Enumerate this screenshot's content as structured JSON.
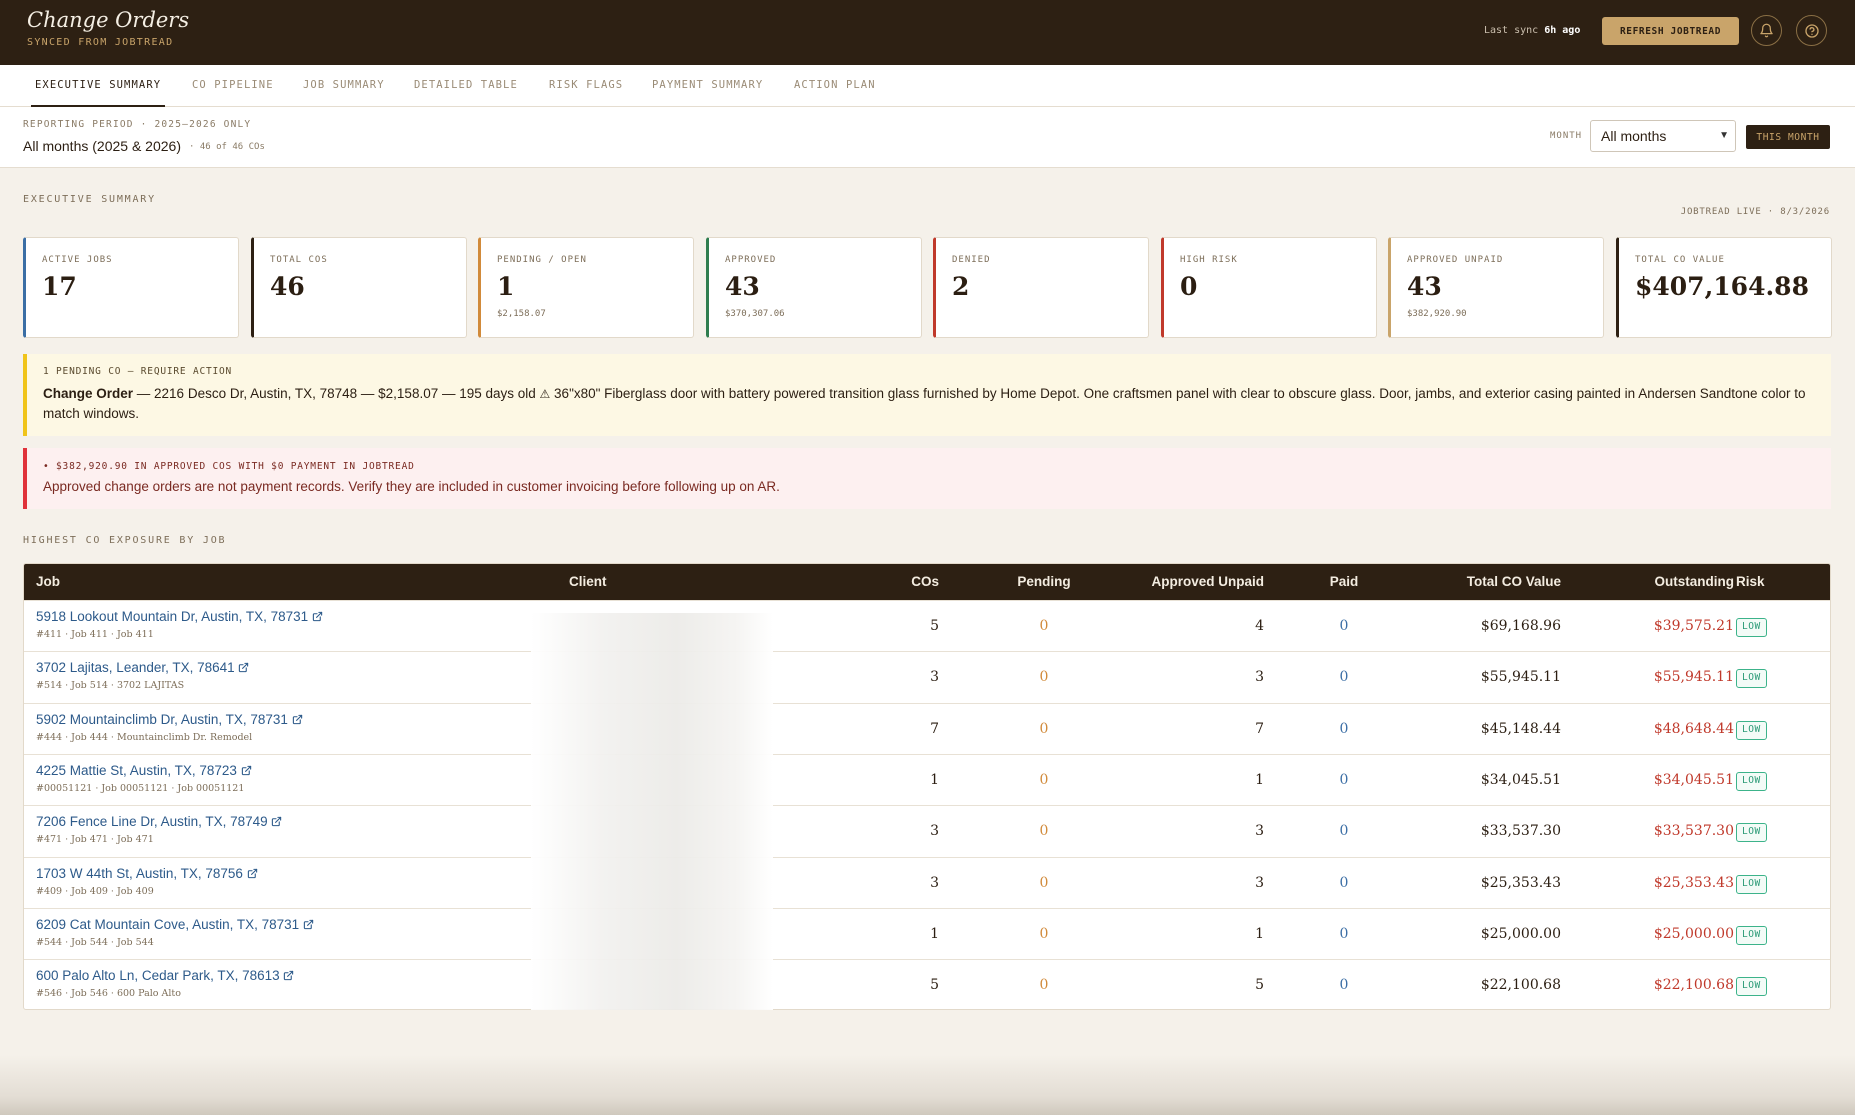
{
  "header": {
    "title": "Change Orders",
    "subtitle": "SYNCED FROM JOBTREAD",
    "sync_prefix": "Last sync",
    "sync_value": "6h ago",
    "refresh_label": "REFRESH JOBTREAD",
    "bell_icon": "bell-icon",
    "help_icon": "help-circle-icon"
  },
  "tabs": [
    {
      "label": "EXECUTIVE SUMMARY",
      "active": true
    },
    {
      "label": "CO PIPELINE",
      "active": false
    },
    {
      "label": "JOB SUMMARY",
      "active": false
    },
    {
      "label": "DETAILED TABLE",
      "active": false
    },
    {
      "label": "RISK FLAGS",
      "active": false
    },
    {
      "label": "PAYMENT SUMMARY",
      "active": false
    },
    {
      "label": "ACTION PLAN",
      "active": false
    }
  ],
  "period": {
    "label": "REPORTING PERIOD · 2025–2026 ONLY",
    "value": "All months (2025 & 2026)",
    "count": "· 46 of 46 COs",
    "month_label": "MONTH",
    "month_selected": "All months",
    "this_month_label": "THIS MONTH"
  },
  "summary": {
    "section_label": "EXECUTIVE SUMMARY",
    "live_label": "JOBTREAD LIVE · 8/3/2026",
    "cards": [
      {
        "label": "ACTIVE JOBS",
        "value": "17",
        "sub": "",
        "accent": "#3b6ea5"
      },
      {
        "label": "TOTAL COS",
        "value": "46",
        "sub": "",
        "accent": "#2d2013"
      },
      {
        "label": "PENDING / OPEN",
        "value": "1",
        "sub": "$2,158.07",
        "accent": "#d18a3a"
      },
      {
        "label": "APPROVED",
        "value": "43",
        "sub": "$370,307.06",
        "accent": "#2f7d4f"
      },
      {
        "label": "DENIED",
        "value": "2",
        "sub": "",
        "accent": "#c0392b"
      },
      {
        "label": "HIGH RISK",
        "value": "0",
        "sub": "",
        "accent": "#c0392b"
      },
      {
        "label": "APPROVED UNPAID",
        "value": "43",
        "sub": "$382,920.90",
        "accent": "#c9a46a"
      },
      {
        "label": "TOTAL CO VALUE",
        "value": "$407,164.88",
        "sub": "",
        "accent": "#2d2013"
      }
    ]
  },
  "alerts": {
    "pending": {
      "title": "1 PENDING CO — REQUIRE ACTION",
      "co_label": "Change Order",
      "detail": " — 2216 Desco Dr, Austin, TX, 78748 — $2,158.07 — 195 days old ",
      "warning_icon": "warning-triangle-icon",
      "description": " 36\"x80\" Fiberglass door with battery powered transition glass furnished by Home Depot. One craftsmen panel with clear to obscure glass. Door, jambs, and exterior casing painted in Andersen Sandtone color to match windows.",
      "accent": "#f0c419"
    },
    "unpaid": {
      "title": "• $382,920.90 IN APPROVED COS WITH $0 PAYMENT IN JOBTREAD",
      "body": "Approved change orders are not payment records. Verify they are included in customer invoicing before following up on AR.",
      "accent": "#e0323a"
    }
  },
  "exposure": {
    "section_label": "HIGHEST CO EXPOSURE BY JOB",
    "columns": {
      "job": "Job",
      "client": "Client",
      "cos": "COs",
      "pending": "Pending",
      "approved_unpaid": "Approved Unpaid",
      "paid": "Paid",
      "total": "Total CO Value",
      "outstanding": "Outstanding",
      "risk": "Risk"
    },
    "rows": [
      {
        "job": "5918 Lookout Mountain Dr, Austin, TX, 78731",
        "sub": "#411 · Job 411 · Job 411",
        "cos": "5",
        "pending": "0",
        "approved_unpaid": "4",
        "paid": "0",
        "total": "$69,168.96",
        "outstanding": "$39,575.21",
        "risk": "LOW"
      },
      {
        "job": "3702 Lajitas, Leander, TX, 78641",
        "sub": "#514 · Job 514 · 3702 LAJITAS",
        "cos": "3",
        "pending": "0",
        "approved_unpaid": "3",
        "paid": "0",
        "total": "$55,945.11",
        "outstanding": "$55,945.11",
        "risk": "LOW"
      },
      {
        "job": "5902 Mountainclimb Dr, Austin, TX, 78731",
        "sub": "#444 · Job 444 · Mountainclimb Dr. Remodel",
        "cos": "7",
        "pending": "0",
        "approved_unpaid": "7",
        "paid": "0",
        "total": "$45,148.44",
        "outstanding": "$48,648.44",
        "risk": "LOW"
      },
      {
        "job": "4225 Mattie St, Austin, TX, 78723",
        "sub": "#00051121 · Job 00051121 · Job 00051121",
        "cos": "1",
        "pending": "0",
        "approved_unpaid": "1",
        "paid": "0",
        "total": "$34,045.51",
        "outstanding": "$34,045.51",
        "risk": "LOW"
      },
      {
        "job": "7206 Fence Line Dr, Austin, TX, 78749",
        "sub": "#471 · Job 471 · Job 471",
        "cos": "3",
        "pending": "0",
        "approved_unpaid": "3",
        "paid": "0",
        "total": "$33,537.30",
        "outstanding": "$33,537.30",
        "risk": "LOW"
      },
      {
        "job": "1703 W 44th St, Austin, TX, 78756",
        "sub": "#409 · Job 409 · Job 409",
        "cos": "3",
        "pending": "0",
        "approved_unpaid": "3",
        "paid": "0",
        "total": "$25,353.43",
        "outstanding": "$25,353.43",
        "risk": "LOW"
      },
      {
        "job": "6209 Cat Mountain Cove, Austin, TX, 78731",
        "sub": "#544 · Job 544 · Job 544",
        "cos": "1",
        "pending": "0",
        "approved_unpaid": "1",
        "paid": "0",
        "total": "$25,000.00",
        "outstanding": "$25,000.00",
        "risk": "LOW"
      },
      {
        "job": "600 Palo Alto Ln, Cedar Park, TX, 78613",
        "sub": "#546 · Job 546 · 600 Palo Alto",
        "cos": "5",
        "pending": "0",
        "approved_unpaid": "5",
        "paid": "0",
        "total": "$22,100.68",
        "outstanding": "$22,100.68",
        "risk": "LOW"
      }
    ],
    "colors": {
      "pending": "#d18a3a",
      "paid": "#3b6ea5",
      "outstanding": "#c0392b",
      "link": "#2d5a8a"
    }
  }
}
